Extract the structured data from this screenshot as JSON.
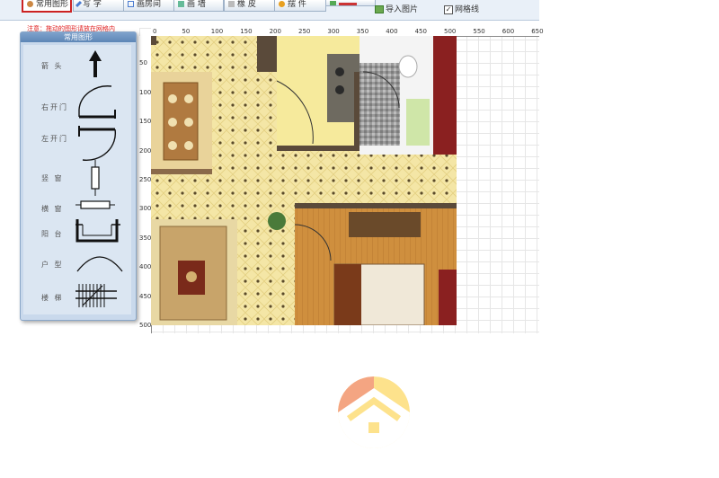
{
  "toolbar": {
    "buttons": [
      {
        "label": "常用图形",
        "active": true
      },
      {
        "label": "写 字"
      },
      {
        "label": "画房间"
      },
      {
        "label": "画 墙"
      },
      {
        "label": "橡 皮"
      },
      {
        "label": "摆 件"
      }
    ],
    "import_image_label": "导入图片",
    "grid_label": "网格线",
    "grid_checked": "✓"
  },
  "notice": "注意：拖动的图形请放在网格内",
  "panel": {
    "title": "常用图形",
    "shapes": [
      {
        "label": "箭 头",
        "icon": "arrow-up-icon"
      },
      {
        "label": "右开门",
        "icon": "right-door-icon"
      },
      {
        "label": "左开门",
        "icon": "left-door-icon"
      },
      {
        "label": "竖 窗",
        "icon": "vertical-window-icon"
      },
      {
        "label": "横 窗",
        "icon": "horizontal-window-icon"
      },
      {
        "label": "阳 台",
        "icon": "balcony-icon"
      },
      {
        "label": "户 型",
        "icon": "floorplan-arc-icon"
      },
      {
        "label": "楼 梯",
        "icon": "stairs-icon"
      }
    ]
  },
  "ruler": {
    "top": [
      "0",
      "50",
      "100",
      "150",
      "200",
      "250",
      "300",
      "350",
      "400",
      "450",
      "500",
      "550",
      "600",
      "650"
    ],
    "left": [
      "50",
      "100",
      "150",
      "200",
      "250",
      "300",
      "350",
      "400",
      "450",
      "500"
    ]
  },
  "colors": {
    "accent": "#c22222",
    "floor_tile": "#f3e3a0",
    "wood_floor": "#c98a3a",
    "wall": "#5a4a3a",
    "logo_orange": "#f4a582",
    "logo_yellow": "#fde28c"
  }
}
